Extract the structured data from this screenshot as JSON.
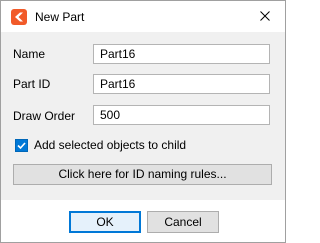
{
  "window": {
    "title": "New Part",
    "app_icon": "app-logo-icon",
    "close_icon": "close-icon"
  },
  "form": {
    "name_label": "Name",
    "name_value": "Part16",
    "part_id_label": "Part ID",
    "part_id_value": "Part16",
    "draw_order_label": "Draw Order",
    "draw_order_value": "500",
    "add_selected_label": "Add selected objects to child",
    "add_selected_checked": true,
    "rules_button_label": "Click here for ID naming rules..."
  },
  "footer": {
    "ok_label": "OK",
    "cancel_label": "Cancel"
  },
  "colors": {
    "accent": "#0078d7",
    "logo": "#f15a29",
    "content_bg": "#f0f0f0"
  }
}
